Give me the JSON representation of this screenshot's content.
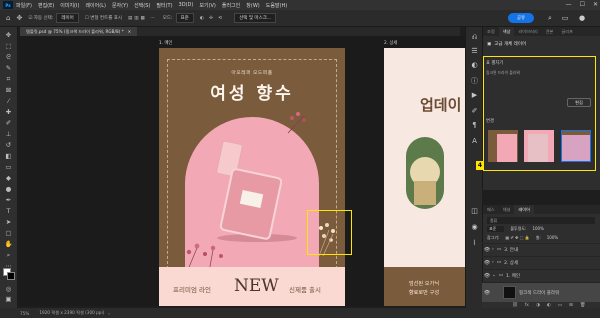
{
  "menubar": {
    "logo": "Ps",
    "items": [
      "파일(F)",
      "편집(E)",
      "이미지(I)",
      "레이어(L)",
      "문자(Y)",
      "선택(S)",
      "필터(T)",
      "3D(D)",
      "보기(V)",
      "플러그인",
      "창(W)",
      "도움말(H)"
    ],
    "controls": [
      "—",
      "☐",
      "✕"
    ]
  },
  "optionsbar": {
    "tool_label": "자동 선택:",
    "select_value": "레이어",
    "transform_label": "변형 컨트롤 표시",
    "mode_label": "모드:",
    "mode_value": "표준",
    "share_label": "공유",
    "select_mask_label": "선택 및 마스크..."
  },
  "document": {
    "tab_title": "템플릿.psd @ 75% (핑크색 드라이 플라워, RGB/8) *",
    "artboard1_label": "1. 메인",
    "artboard2_label": "2. 상세"
  },
  "artboard1": {
    "subtitle": "아모레퍼 모드퍼퓸",
    "title": "여성 향수",
    "bottom_left": "프리미엄 라인",
    "bottom_center": "NEW",
    "bottom_right": "신제품 출시"
  },
  "artboard2": {
    "title": "업데이",
    "bottom_line1": "엄선된 오가닉",
    "bottom_line2": "향료로만 구성"
  },
  "statusbar": {
    "zoom": "75%",
    "doc_size": "1920 픽셀 x 2390 픽셀 (300 ppi)"
  },
  "properties_panel": {
    "tabs": [
      "조정",
      "색상",
      "라이브러리",
      "견본",
      "글리프"
    ],
    "active_tab": "색상",
    "layer_type": "고급 개체 레이어",
    "comps_section": "표 펼치기",
    "comps_text": "링크된 드라이 플라워",
    "edit_button": "편집",
    "transform_section": "변경",
    "step_badge": "4"
  },
  "layers_panel": {
    "tabs": [
      "패스",
      "채널",
      "레이어"
    ],
    "active_tab": "레이어",
    "search_placeholder": "종류",
    "blend_mode": "표준",
    "opacity_label": "불투명도:",
    "opacity_value": "100%",
    "fill_label": "칠:",
    "fill_value": "100%",
    "lock_label": "잠그기:",
    "layers": [
      {
        "name": "3. 안내",
        "type": "group"
      },
      {
        "name": "2. 상세",
        "type": "group"
      },
      {
        "name": "1. 메인",
        "type": "group"
      },
      {
        "name": "핑크색 드라이 플라워",
        "type": "smart"
      }
    ]
  }
}
